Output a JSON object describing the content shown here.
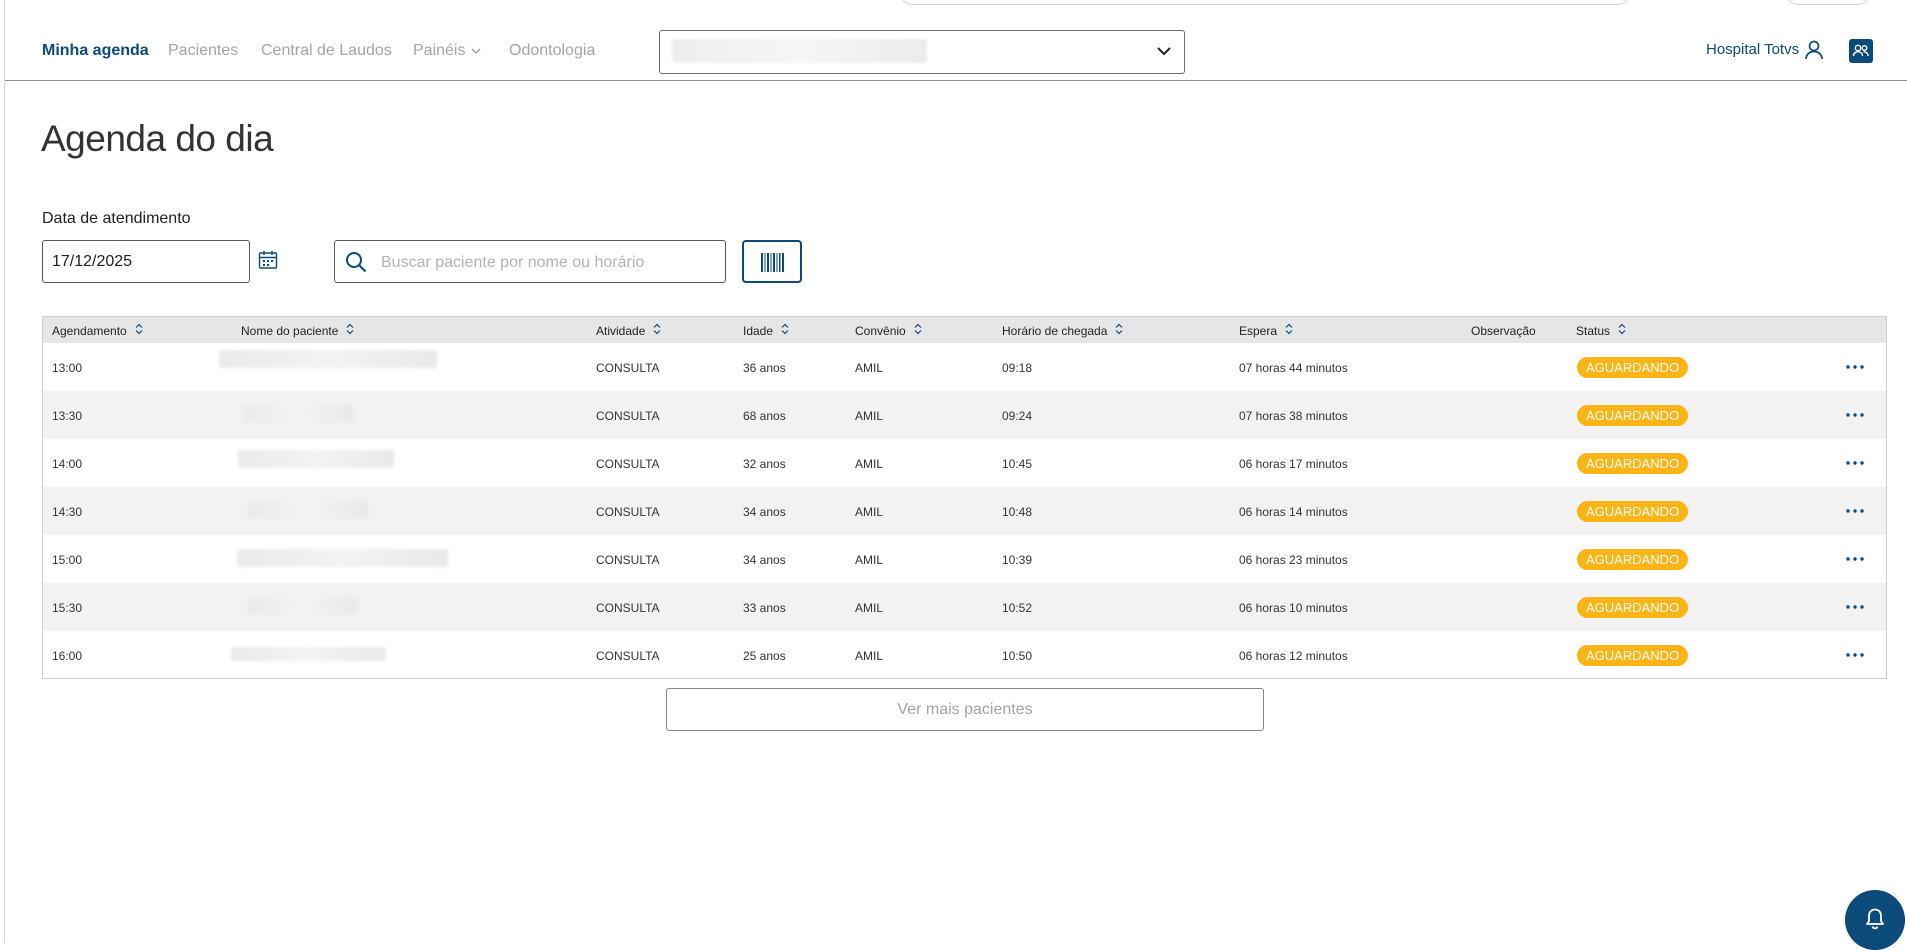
{
  "nav": {
    "items": [
      {
        "label": "Minha agenda",
        "active": true
      },
      {
        "label": "Pacientes",
        "active": false
      },
      {
        "label": "Central de Laudos",
        "active": false
      },
      {
        "label": "Painéis",
        "active": false,
        "has_dropdown": true
      },
      {
        "label": "Odontologia",
        "active": false
      }
    ],
    "unit_select_value": "",
    "hospital_name": "Hospital Totvs",
    "icons": {
      "user": "user-icon",
      "team": "team-icon",
      "dropdown": "chevron-down-icon"
    }
  },
  "page": {
    "title": "Agenda do dia",
    "date_label": "Data de atendimento",
    "date_value": "17/12/2025",
    "search_placeholder": "Buscar paciente por nome ou horário",
    "more_button": "Ver mais pacientes"
  },
  "table": {
    "headers": [
      "Agendamento",
      "Nome do paciente",
      "Atividade",
      "Idade",
      "Convênio",
      "Horário de chegada",
      "Espera",
      "Observação",
      "Status"
    ],
    "rows": [
      {
        "agendamento": "13:00",
        "atividade": "CONSULTA",
        "idade": "36 anos",
        "convenio": "AMIL",
        "chegada": "09:18",
        "espera": "07 horas 44 minutos",
        "observacao": "",
        "status": "AGUARDANDO"
      },
      {
        "agendamento": "13:30",
        "atividade": "CONSULTA",
        "idade": "68 anos",
        "convenio": "AMIL",
        "chegada": "09:24",
        "espera": "07 horas 38 minutos",
        "observacao": "",
        "status": "AGUARDANDO"
      },
      {
        "agendamento": "14:00",
        "atividade": "CONSULTA",
        "idade": "32 anos",
        "convenio": "AMIL",
        "chegada": "10:45",
        "espera": "06 horas 17 minutos",
        "observacao": "",
        "status": "AGUARDANDO"
      },
      {
        "agendamento": "14:30",
        "atividade": "CONSULTA",
        "idade": "34 anos",
        "convenio": "AMIL",
        "chegada": "10:48",
        "espera": "06 horas 14 minutos",
        "observacao": "",
        "status": "AGUARDANDO"
      },
      {
        "agendamento": "15:00",
        "atividade": "CONSULTA",
        "idade": "34 anos",
        "convenio": "AMIL",
        "chegada": "10:39",
        "espera": "06 horas 23 minutos",
        "observacao": "",
        "status": "AGUARDANDO"
      },
      {
        "agendamento": "15:30",
        "atividade": "CONSULTA",
        "idade": "33 anos",
        "convenio": "AMIL",
        "chegada": "10:52",
        "espera": "06 horas 10 minutos",
        "observacao": "",
        "status": "AGUARDANDO"
      },
      {
        "agendamento": "16:00",
        "atividade": "CONSULTA",
        "idade": "25 anos",
        "convenio": "AMIL",
        "chegada": "10:50",
        "espera": "06 horas 12 minutos",
        "observacao": "",
        "status": "AGUARDANDO"
      }
    ]
  },
  "colors": {
    "primary": "#0c4a7a",
    "status_waiting": "#fcb315",
    "muted": "#a1a6ab"
  }
}
